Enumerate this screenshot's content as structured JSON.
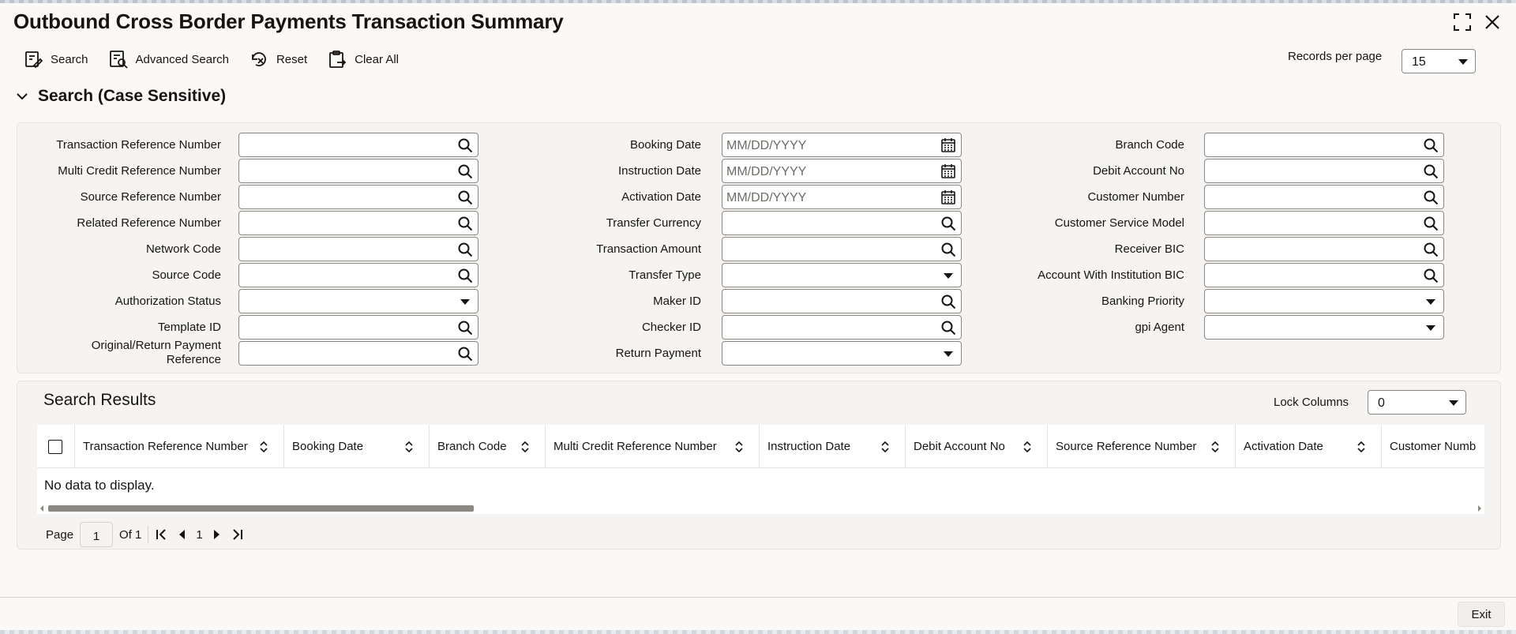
{
  "window": {
    "title": "Outbound Cross Border Payments Transaction Summary"
  },
  "toolbar": {
    "search": "Search",
    "advanced_search": "Advanced Search",
    "reset": "Reset",
    "clear_all": "Clear All"
  },
  "records_per_page": {
    "label": "Records per page",
    "value": "15"
  },
  "search_section": {
    "title": "Search (Case Sensitive)"
  },
  "fields": {
    "col1": [
      {
        "label": "Transaction Reference Number",
        "value": "",
        "control": "search"
      },
      {
        "label": "Multi Credit Reference Number",
        "value": "",
        "control": "search"
      },
      {
        "label": "Source Reference Number",
        "value": "",
        "control": "search"
      },
      {
        "label": "Related Reference Number",
        "value": "",
        "control": "search"
      },
      {
        "label": "Network Code",
        "value": "",
        "control": "search"
      },
      {
        "label": "Source Code",
        "value": "",
        "control": "search"
      },
      {
        "label": "Authorization Status",
        "value": "",
        "control": "dropdown"
      },
      {
        "label": "Template ID",
        "value": "",
        "control": "search"
      },
      {
        "label": "Original/Return Payment Reference",
        "value": "",
        "control": "search"
      }
    ],
    "col2": [
      {
        "label": "Booking Date",
        "placeholder": "MM/DD/YYYY",
        "control": "date"
      },
      {
        "label": "Instruction Date",
        "placeholder": "MM/DD/YYYY",
        "control": "date"
      },
      {
        "label": "Activation Date",
        "placeholder": "MM/DD/YYYY",
        "control": "date"
      },
      {
        "label": "Transfer Currency",
        "value": "",
        "control": "search"
      },
      {
        "label": "Transaction Amount",
        "value": "",
        "control": "search"
      },
      {
        "label": "Transfer Type",
        "value": "",
        "control": "dropdown"
      },
      {
        "label": "Maker ID",
        "value": "",
        "control": "search"
      },
      {
        "label": "Checker ID",
        "value": "",
        "control": "search"
      },
      {
        "label": "Return Payment",
        "value": "",
        "control": "dropdown"
      }
    ],
    "col3": [
      {
        "label": "Branch Code",
        "value": "",
        "control": "search"
      },
      {
        "label": "Debit Account No",
        "value": "",
        "control": "search"
      },
      {
        "label": "Customer Number",
        "value": "",
        "control": "search"
      },
      {
        "label": "Customer Service Model",
        "value": "",
        "control": "search"
      },
      {
        "label": "Receiver BIC",
        "value": "",
        "control": "search"
      },
      {
        "label": "Account With Institution BIC",
        "value": "",
        "control": "search"
      },
      {
        "label": "Banking Priority",
        "value": "",
        "control": "dropdown"
      },
      {
        "label": "gpi Agent",
        "value": "",
        "control": "dropdown"
      }
    ]
  },
  "results": {
    "title": "Search Results",
    "lock_columns_label": "Lock Columns",
    "lock_columns_value": "0",
    "columns": [
      "Transaction Reference Number",
      "Booking Date",
      "Branch Code",
      "Multi Credit Reference Number",
      "Instruction Date",
      "Debit Account No",
      "Source Reference Number",
      "Activation Date",
      "Customer Numb"
    ],
    "empty_message": "No data to display."
  },
  "pagination": {
    "page_label": "Page",
    "page_value": "1",
    "of_label": "Of 1",
    "current": "1"
  },
  "footer": {
    "exit": "Exit"
  }
}
